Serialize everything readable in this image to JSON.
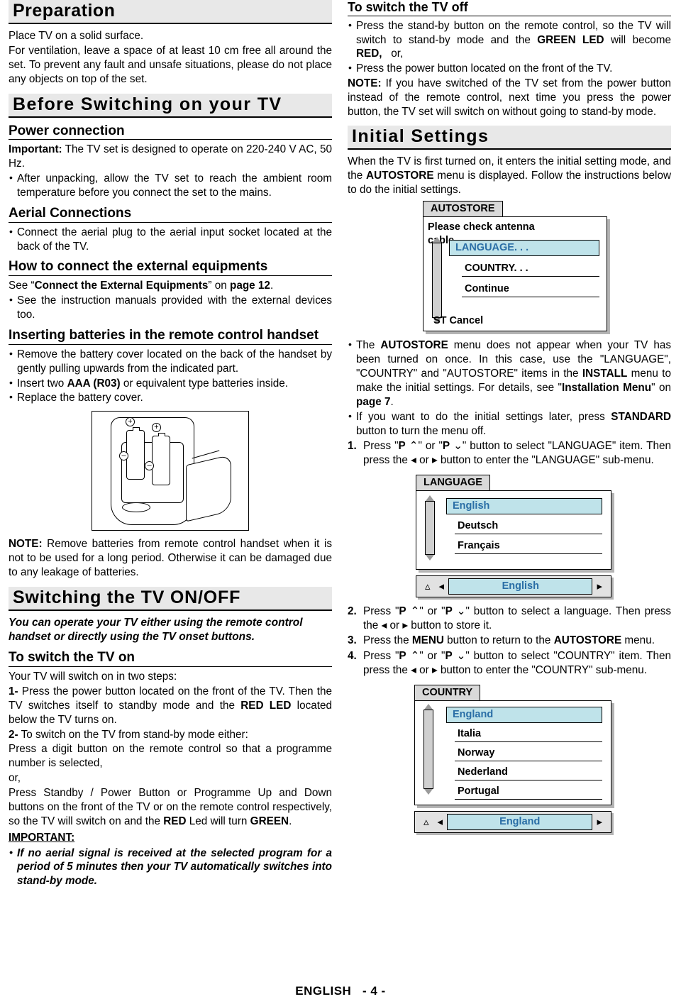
{
  "left": {
    "heading_preparation": "Preparation",
    "prep_p1": "Place TV on a solid surface.",
    "prep_p2": "For ventilation, leave a space of at least 10 cm free all around the set. To prevent any fault and unsafe situations, please do not place any objects on top of the set.",
    "heading_before_switching": "Before  Switching  on  your  TV",
    "heading_power_connection": "Power connection",
    "power_important_label": "Important:",
    "power_important_text": " The TV set is designed to operate on 220-240 V AC, 50 Hz.",
    "power_bullet": "After unpacking, allow the TV set to reach the ambient room temperature before you connect the set to the mains.",
    "heading_aerial": "Aerial Connections",
    "aerial_bullet": "Connect the aerial plug to the aerial input socket located at the back of the TV.",
    "heading_external": "How to connect the external equipments",
    "external_see_pre": "See “",
    "external_see_bold": "Connect the External Equipments",
    "external_see_mid": "” on ",
    "external_see_page": "page 12",
    "external_see_end": ".",
    "external_bullet": "See the instruction manuals provided with the external devices too.",
    "heading_batteries": "Inserting batteries in the remote control handset",
    "batt_b1": "Remove the battery cover located on the back of the handset by gently pulling upwards from the indicated part.",
    "batt_b2_pre": "Insert two ",
    "batt_b2_bold": "AAA (R03)",
    "batt_b2_post": " or equivalent type batteries inside.",
    "batt_b3": "Replace the battery cover.",
    "note_label": "NOTE:",
    "note_text": " Remove batteries from remote control handset when it is not to be used for a long period. Otherwise it can be damaged due to any leakage of batteries.",
    "heading_switching": "Switching  the  TV  ON/OFF",
    "switching_italic": "You can operate your TV either using the remote control handset or directly using the TV onset buttons.",
    "heading_tv_on": "To switch the TV on",
    "tv_on_p1": "Your TV will switch on in two steps:",
    "tv_on_step1_num": "1-",
    "tv_on_step1_a": " Press the power button located on the front of the TV. Then the TV switches itself to standby mode and the ",
    "tv_on_step1_bold": "RED LED",
    "tv_on_step1_b": " located below the TV turns on.",
    "tv_on_step2_num": "2-",
    "tv_on_step2": " To switch on the TV from stand-by mode either:",
    "tv_on_p2": "Press a digit button on the remote control so that a programme number is selected,",
    "tv_on_or": "or,",
    "tv_on_p3_a": "Press Standby / Power Button or Programme Up and Down buttons on the front of the TV or on the remote control respectively, so the TV will switch on and the ",
    "tv_on_p3_bold": "RED",
    "tv_on_p3_b": " Led will turn ",
    "tv_on_p3_bold2": "GREEN",
    "tv_on_p3_c": ".",
    "important_label": "IMPORTANT:",
    "important_italic": "If no aerial signal is received at the selected program for a period of 5 minutes then your TV automatically switches into stand-by mode."
  },
  "right": {
    "heading_tv_off": "To switch the TV off",
    "off_b1_a": "Press the stand-by button on the remote control, so the TV will switch to stand-by mode and the ",
    "off_b1_bold": "GREEN LED",
    "off_b1_b": " will become ",
    "off_b1_bold2": "RED,",
    "off_b1_or": "or,",
    "off_b2": "Press the power button located on the front of the TV.",
    "off_note_label": "NOTE:",
    "off_note_text": " If you have switched of the TV set from the power button instead of the remote control, next time you press the power button, the TV set will switch on without going to stand-by mode.",
    "heading_initial": "Initial  Settings",
    "initial_p_a": "When the TV is first turned on, it enters the initial setting mode, and the ",
    "initial_p_bold": "AUTOSTORE",
    "initial_p_b": " menu is displayed. Follow the instructions below to do the initial settings.",
    "osd_autostore": {
      "title": "AUTOSTORE",
      "prompt_line1": "Please  check  antenna",
      "prompt_line2": "cable.",
      "item_language": "LANGUAGE. . .",
      "item_country": "COUNTRY. . .",
      "item_continue": "Continue",
      "footer": "ST   Cancel"
    },
    "b1_a": "The ",
    "b1_bold": "AUTOSTORE",
    "b1_b": " menu does not appear when your TV has been turned on once. In this case, use the \"LANGUAGE\", \"COUNTRY\" and \"AUTOSTORE\" items in the ",
    "b1_bold2": "INSTALL",
    "b1_c": " menu to make the initial settings. For details, see \"",
    "b1_bold3": "Installation Menu",
    "b1_d": "\" on ",
    "b1_page": "page 7",
    "b1_e": ".",
    "b2_a": "If you want to do the initial settings later, press ",
    "b2_bold": "STANDARD",
    "b2_b": " button to turn the menu off.",
    "step1_num": "1.",
    "step1_a": " Press \"",
    "step1_bold1": "P",
    "step1_mid": "\" or \"",
    "step1_bold2": "P",
    "step1_b": "\" button to select \"LANGUAGE\" item. Then press the ",
    "step1_c": " or ",
    "step1_d": " button to enter the \"LANGUAGE\" sub-menu.",
    "osd_language": {
      "title": "LANGUAGE",
      "items": [
        "English",
        "Deutsch",
        "Français"
      ],
      "selected": "English",
      "selbar_value": "English"
    },
    "step2_num": "2.",
    "step2_a": " Press \"",
    "step2_b": "\" or \"",
    "step2_c": "\" button to select a language. Then press the ",
    "step2_d": " or ",
    "step2_e": " button to store it.",
    "step3_num": "3.",
    "step3_a": " Press the ",
    "step3_bold": "MENU",
    "step3_b": " button to return to the ",
    "step3_bold2": "AUTOSTORE",
    "step3_c": " menu.",
    "step4_num": "4.",
    "step4_a": " Press \"",
    "step4_b": "\" or \"",
    "step4_c": "\" button to select \"COUNTRY\" item. Then press the ",
    "step4_d": " or ",
    "step4_e": " button to enter the \"COUNTRY\" sub-menu.",
    "osd_country": {
      "title": "COUNTRY",
      "items": [
        "England",
        "Italia",
        "Norway",
        "Nederland",
        "Portugal"
      ],
      "selected": "England",
      "selbar_value": "England"
    }
  },
  "footer": {
    "language": "ENGLISH",
    "page": "- 4 -"
  },
  "colors": {
    "heading_band": "#e8e8e8",
    "osd_highlight": "#bfe3ea",
    "osd_title_bg": "#d9d9d9",
    "shadow": "#b4b4b4"
  }
}
